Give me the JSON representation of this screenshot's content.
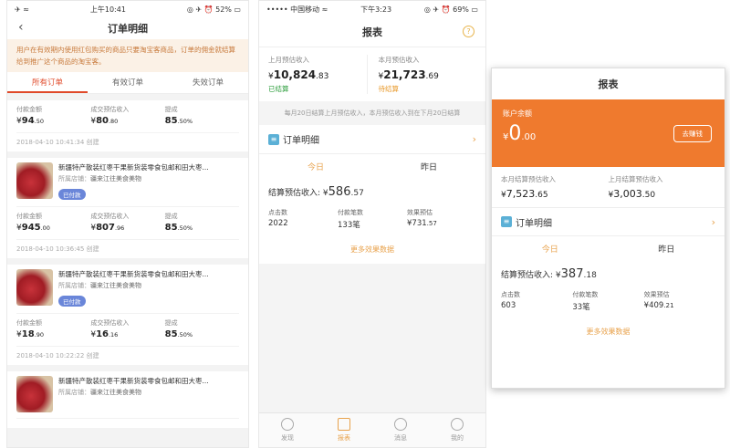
{
  "screen1": {
    "status": {
      "left": "✈ ≈",
      "time": "上午10:41",
      "right": "◎ ✈ ⏰ 52% ▭"
    },
    "title": "订单明细",
    "notice": "用户在有效期内使用红包购买的商品只要淘宝客商品，订单的佣金就结算给到推广这个商品的淘宝客。",
    "tabs": [
      "所有订单",
      "有效订单",
      "失效订单"
    ],
    "labels": {
      "pay": "付款金额",
      "est": "成交预估收入",
      "rate": "提成"
    },
    "created": "创建",
    "orders": [
      {
        "pay_main": "94",
        "pay_dec": ".50",
        "est_main": "80",
        "est_dec": ".80",
        "rate_main": "85",
        "rate_dec": ".50%",
        "time": "2018-04-10 10:41:34"
      },
      {
        "title": "新疆特产散装红枣干果新货装零食包邮和田大枣...",
        "shop_label": "所属店铺：",
        "shop": "疆来江往美食美物",
        "status": "已付款",
        "pay_main": "945",
        "pay_dec": ".00",
        "est_main": "807",
        "est_dec": ".96",
        "rate_main": "85",
        "rate_dec": ".50%",
        "time": "2018-04-10 10:36:45"
      },
      {
        "title": "新疆特产散装红枣干果新货装零食包邮和田大枣...",
        "shop_label": "所属店铺：",
        "shop": "疆来江往美食美物",
        "status": "已付款",
        "pay_main": "18",
        "pay_dec": ".90",
        "est_main": "16",
        "est_dec": ".16",
        "rate_main": "85",
        "rate_dec": ".50%",
        "time": "2018-04-10 10:22:22"
      },
      {
        "title": "新疆特产散装红枣干果新货装零食包邮和田大枣...",
        "shop_label": "所属店铺：",
        "shop": "疆来江往美食美物"
      }
    ]
  },
  "screen2": {
    "status": {
      "left": "••••• 中国移动 ≈",
      "time": "下午3:23",
      "right": "◎ ✈ ⏰ 69% ▭"
    },
    "title": "报表",
    "help": "?",
    "last_label": "上月预估收入",
    "last_main": "10,824",
    "last_dec": ".83",
    "last_status": "已结算",
    "this_label": "本月预估收入",
    "this_main": "21,723",
    "this_dec": ".69",
    "this_status": "待结算",
    "note": "每月20日结算上月预估收入，本月预估收入到在下月20日结算",
    "orders": "订单明细",
    "tabs": [
      "今日",
      "昨日"
    ],
    "est_label": "结算预估收入:",
    "est_main": "586",
    "est_dec": ".57",
    "kpi": [
      {
        "label": "点击数",
        "value": "2022"
      },
      {
        "label": "付款笔数",
        "value": "133笔"
      },
      {
        "label": "效果预估",
        "value_main": "731",
        "value_dec": ".57"
      }
    ],
    "more": "更多效果数据",
    "nav": [
      "发现",
      "报表",
      "消息",
      "我的"
    ]
  },
  "screen3": {
    "title": "报表",
    "balance_label": "账户余额",
    "balance_main": "0",
    "balance_dec": ".00",
    "earn": "去赚钱",
    "this_settle_label": "本月结算预估收入",
    "this_settle_main": "7,523",
    "this_settle_dec": ".65",
    "last_settle_label": "上月结算预估收入",
    "last_settle_main": "3,003",
    "last_settle_dec": ".50",
    "orders": "订单明细",
    "tabs": [
      "今日",
      "昨日"
    ],
    "est_label": "结算预估收入:",
    "est_main": "387",
    "est_dec": ".18",
    "kpi": [
      {
        "label": "点击数",
        "value": "603"
      },
      {
        "label": "付款笔数",
        "value": "33笔"
      },
      {
        "label": "效果预估",
        "value_main": "409",
        "value_dec": ".21"
      }
    ],
    "more": "更多效果数据"
  },
  "currency": "¥",
  "colors": {
    "accent_red": "#e04a2a",
    "accent_orange": "#e8a24c",
    "balance_bg": "#ef7a2e",
    "settled_green": "#2e9e3e",
    "pending_orange": "#e89a2c"
  }
}
